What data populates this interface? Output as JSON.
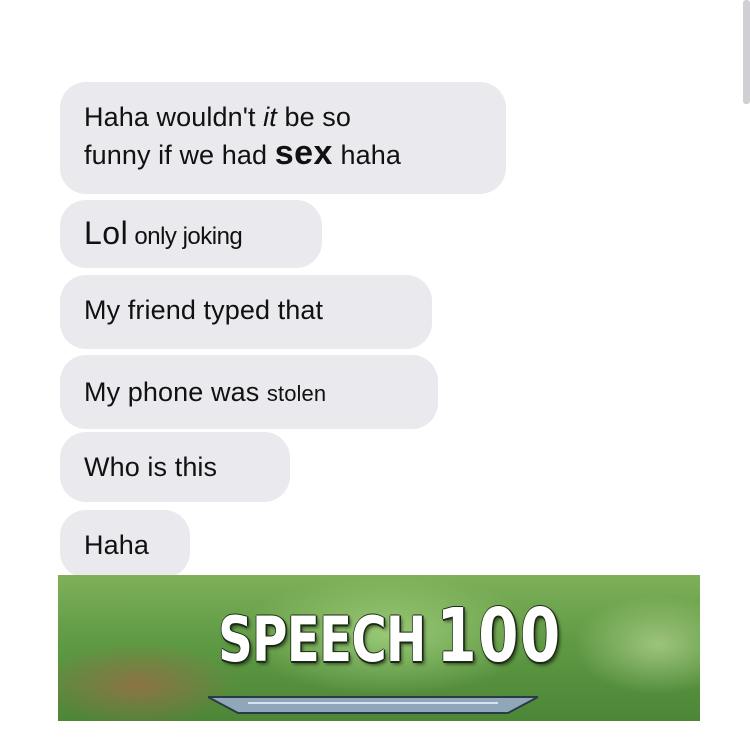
{
  "messages": [
    {
      "line1": {
        "a": "Haha wouldn't ",
        "b": "it",
        "c": " be so"
      },
      "line2": {
        "a": "funny if we had ",
        "b": "sex",
        "c": " haha"
      }
    },
    {
      "a": "Lol",
      "b": " only joking"
    },
    {
      "text": "My friend typed that"
    },
    {
      "a": "My phone was ",
      "b": "stolen"
    },
    {
      "text": "Who is this"
    },
    {
      "text": "Haha"
    }
  ],
  "banner": {
    "skill": "SPEECH",
    "level": "100"
  },
  "colors": {
    "bubble": "#e9e9ee",
    "text": "#111111",
    "banner_green": "#5f9a44"
  }
}
